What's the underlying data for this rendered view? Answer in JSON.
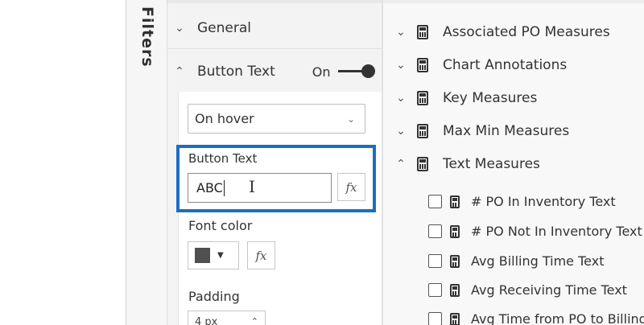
{
  "filters_pane": {
    "label": "Filters"
  },
  "format_pane": {
    "general": {
      "label": "General"
    },
    "button_text_section": {
      "label": "Button Text",
      "toggle_label": "On",
      "toggle_on": true
    },
    "state_dropdown": {
      "selected": "On hover"
    },
    "button_text_field": {
      "label": "Button Text",
      "value": "ABC",
      "fx": "fx"
    },
    "font_color": {
      "label": "Font color",
      "swatch": "#505050",
      "fx": "fx"
    },
    "padding": {
      "label": "Padding",
      "value": "4 px"
    }
  },
  "fields_pane": {
    "groups": [
      {
        "label": "Associated PO Measures",
        "expanded": false
      },
      {
        "label": "Chart Annotations",
        "expanded": false
      },
      {
        "label": "Key Measures",
        "expanded": false
      },
      {
        "label": "Max Min Measures",
        "expanded": false
      },
      {
        "label": "Text Measures",
        "expanded": true
      }
    ],
    "items": [
      {
        "label": "# PO In Inventory Text"
      },
      {
        "label": "# PO Not In Inventory Text"
      },
      {
        "label": "Avg Billing Time Text"
      },
      {
        "label": "Avg Receiving Time Text"
      },
      {
        "label": "Avg Time from PO to Billing"
      }
    ]
  },
  "colors": {
    "highlight": "#1b6ec2",
    "accent_dark": "#333333"
  }
}
